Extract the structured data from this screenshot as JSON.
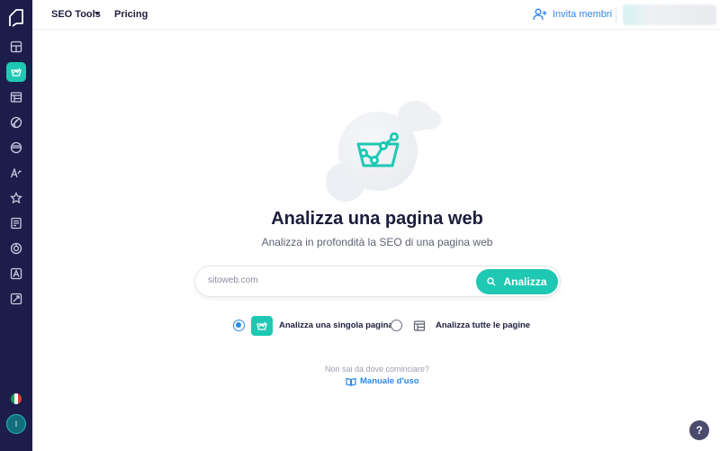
{
  "topbar": {
    "menu": [
      {
        "label": "SEO Tools",
        "has_dropdown": true
      },
      {
        "label": "Pricing"
      }
    ],
    "invite_label": "Invita membri"
  },
  "sidebar": {
    "items": [
      {
        "icon": "dashboard-icon",
        "active": false
      },
      {
        "icon": "seo-checker-icon",
        "active": true
      },
      {
        "icon": "site-audit-icon",
        "active": false
      },
      {
        "icon": "domain-globe-icon",
        "active": false
      },
      {
        "icon": "serp-checker-icon",
        "active": false
      },
      {
        "icon": "keyword-research-icon",
        "active": false
      },
      {
        "icon": "rank-tracker-icon",
        "active": false
      },
      {
        "icon": "content-editor-icon",
        "active": false
      },
      {
        "icon": "competitor-icon",
        "active": false
      },
      {
        "icon": "ai-writer-icon",
        "active": false
      },
      {
        "icon": "reports-icon",
        "active": false
      }
    ],
    "language_flag": "it",
    "avatar_initial": "I"
  },
  "main": {
    "title": "Analizza una pagina web",
    "subtitle": "Analizza in profondità la SEO di una pagina web",
    "search": {
      "placeholder": "sitoweb.com",
      "button_label": "Analizza"
    },
    "options": [
      {
        "label": "Analizza una singola pagina",
        "selected": true,
        "icon": "single-page-icon"
      },
      {
        "label": "Analizza tutte le pagine",
        "selected": false,
        "icon": "all-pages-icon"
      }
    ],
    "hint": "Non sai da dove cominciare?",
    "manual_label": "Manuale d'uso"
  },
  "help_label": "?",
  "colors": {
    "sidebar_bg": "#1c1d4a",
    "accent_teal": "#1ec8b3",
    "link_blue": "#2f88e8",
    "text_dark": "#1c1d3b"
  }
}
